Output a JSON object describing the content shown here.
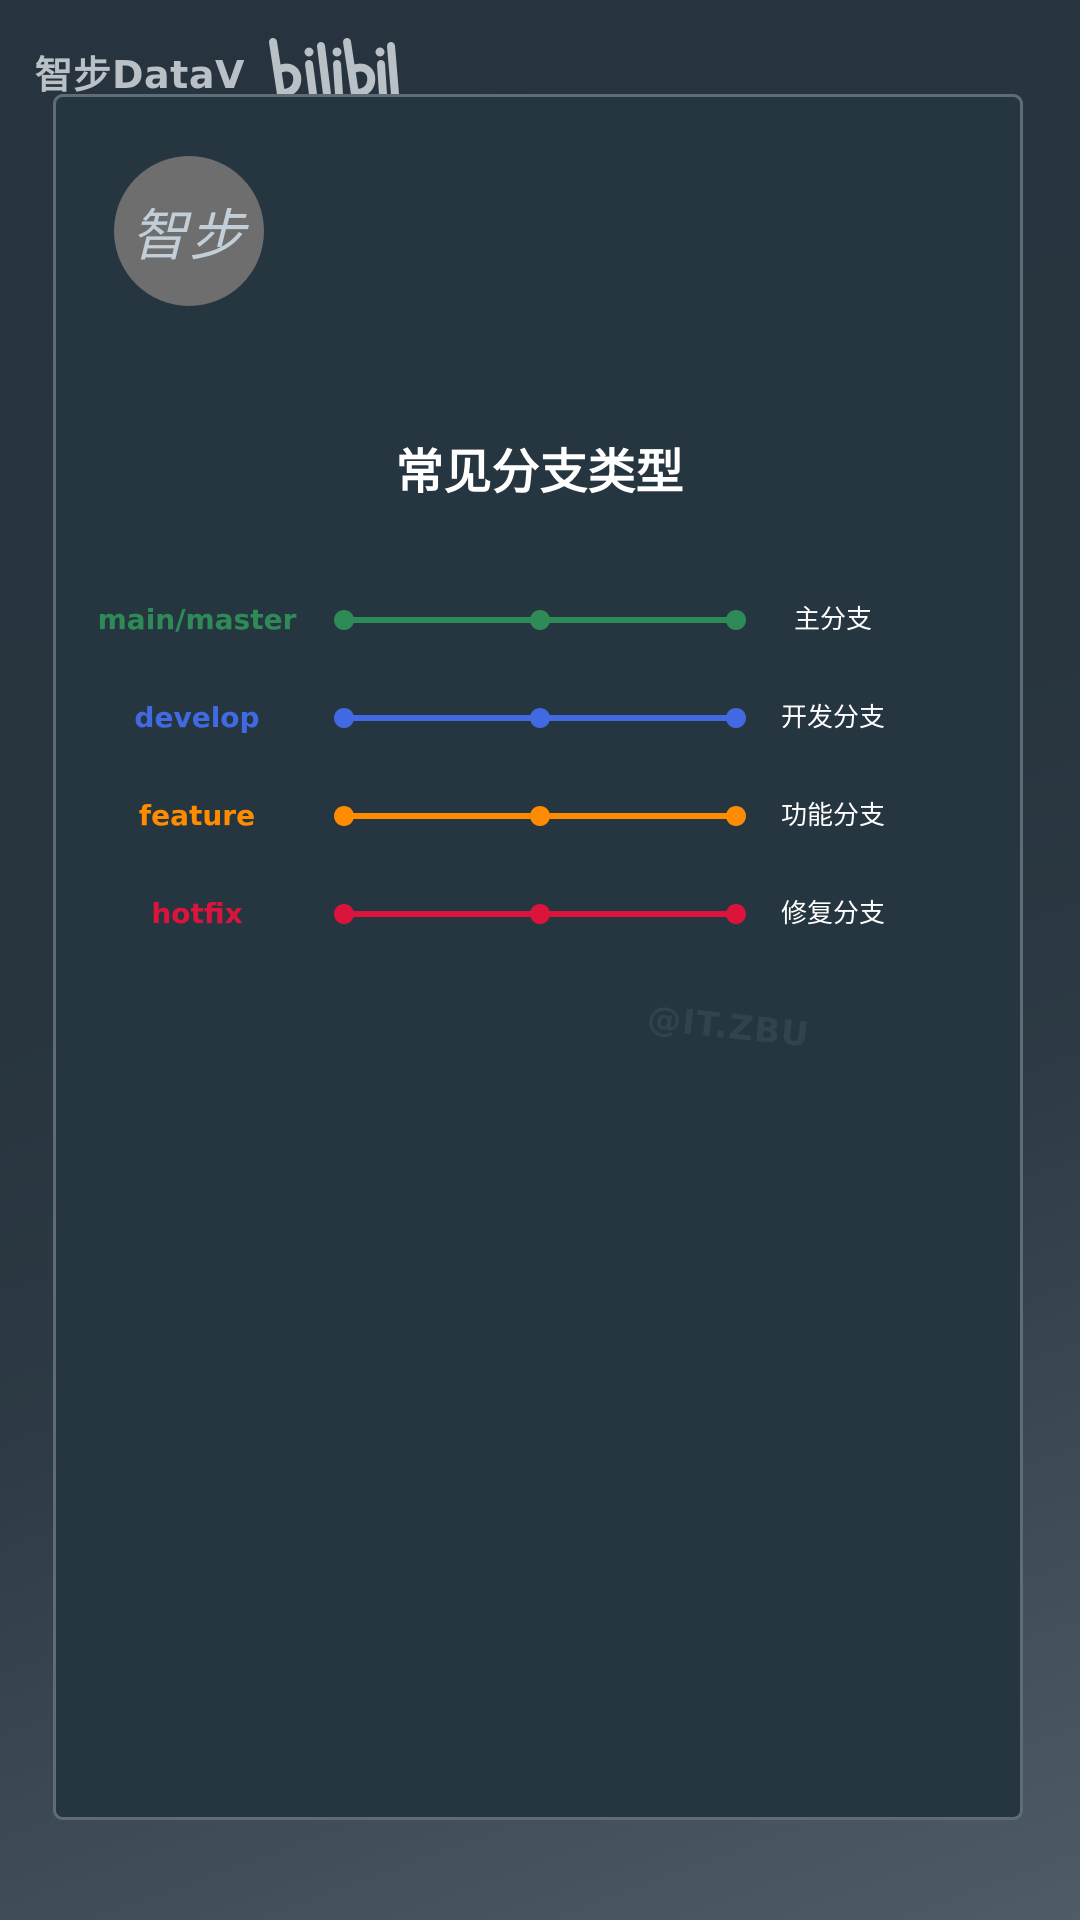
{
  "brand": {
    "name": "智步DataV",
    "logo_icon": "bilibili-logo-icon",
    "color": "#b9c0c6"
  },
  "avatar": {
    "text": "智步",
    "background": "#6e6e6e"
  },
  "diagram": {
    "title": "常见分支类型",
    "branches": [
      {
        "name": "main/master",
        "description": "主分支",
        "color": "#2e8b57",
        "commits": 3
      },
      {
        "name": "develop",
        "description": "开发分支",
        "color": "#4169e1",
        "commits": 3
      },
      {
        "name": "feature",
        "description": "功能分支",
        "color": "#ff8c00",
        "commits": 3
      },
      {
        "name": "hotfix",
        "description": "修复分支",
        "color": "#dc143c",
        "commits": 3
      }
    ]
  },
  "watermark": "@IT.ZBU"
}
